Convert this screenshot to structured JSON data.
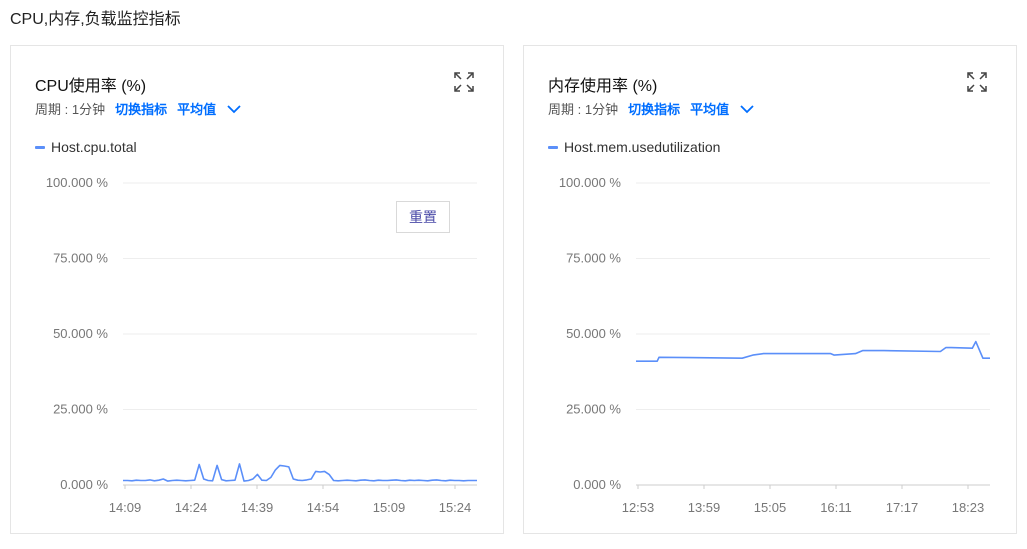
{
  "page": {
    "title": "CPU,内存,负载监控指标"
  },
  "colors": {
    "series": "#5b8ff9",
    "link": "#006eff",
    "grid": "#eeeeee",
    "axis_text": "#777777"
  },
  "icons": {
    "expand": "expand-icon",
    "dropdown": "chevron-down-icon"
  },
  "panels": [
    {
      "title": "CPU使用率 (%)",
      "period_label": "周期 : 1分钟",
      "switch_label": "切换指标",
      "agg_label": "平均值",
      "legend": "Host.cpu.total",
      "reset_label": "重置"
    },
    {
      "title": "内存使用率 (%)",
      "period_label": "周期 : 1分钟",
      "switch_label": "切换指标",
      "agg_label": "平均值",
      "legend": "Host.mem.usedutilization"
    }
  ],
  "chart_data": [
    {
      "type": "line",
      "title": "CPU使用率 (%)",
      "ylim": [
        0,
        100
      ],
      "yticks": [
        0,
        25,
        50,
        75,
        100
      ],
      "ytick_labels": [
        "0.000 %",
        "25.000 %",
        "50.000 %",
        "75.000 %",
        "100.000 %"
      ],
      "xtick_labels": [
        "14:09",
        "14:24",
        "14:39",
        "14:54",
        "15:09",
        "15:24"
      ],
      "grid": true,
      "legend_position": "top-left",
      "series": [
        {
          "name": "Host.cpu.total",
          "x": [
            0,
            1,
            2,
            3,
            4,
            5,
            6,
            7,
            8,
            9,
            10,
            11,
            12,
            13,
            14,
            15,
            16,
            17,
            18,
            19,
            20,
            21,
            22,
            23,
            24,
            25,
            26,
            27,
            28,
            29,
            30,
            31,
            32,
            33,
            34,
            35,
            36,
            37,
            38,
            39,
            40,
            41,
            42,
            43,
            44,
            45,
            46,
            47,
            48,
            49,
            50,
            51,
            52,
            53,
            54,
            55,
            56,
            57,
            58,
            59,
            60,
            61,
            62,
            63,
            64,
            65,
            66,
            67,
            68,
            69,
            70,
            71,
            72,
            73,
            74,
            75,
            76,
            77,
            78,
            79
          ],
          "values": [
            1.5,
            1.5,
            1.4,
            1.6,
            1.5,
            1.5,
            1.7,
            1.4,
            1.6,
            2.0,
            1.3,
            1.5,
            1.6,
            1.5,
            1.4,
            1.5,
            1.6,
            6.8,
            2.0,
            1.5,
            1.4,
            6.5,
            1.8,
            1.4,
            1.5,
            1.6,
            7.0,
            1.3,
            1.5,
            2.0,
            3.5,
            1.6,
            1.5,
            2.5,
            5.0,
            6.5,
            6.3,
            6.0,
            2.0,
            1.6,
            1.5,
            1.7,
            2.0,
            4.5,
            4.3,
            4.5,
            3.5,
            1.5,
            1.4,
            1.5,
            1.6,
            1.5,
            1.4,
            1.6,
            1.7,
            1.5,
            1.4,
            1.6,
            1.5,
            1.5,
            1.6,
            1.7,
            1.5,
            1.4,
            1.6,
            1.5,
            1.6,
            1.5,
            1.4,
            1.6,
            1.7,
            1.5,
            1.4,
            1.6,
            1.5,
            1.5,
            1.4,
            1.5,
            1.5,
            1.5
          ]
        }
      ]
    },
    {
      "type": "line",
      "title": "内存使用率 (%)",
      "ylim": [
        0,
        100
      ],
      "yticks": [
        0,
        25,
        50,
        75,
        100
      ],
      "ytick_labels": [
        "0.000 %",
        "25.000 %",
        "50.000 %",
        "75.000 %",
        "100.000 %"
      ],
      "xtick_labels": [
        "12:53",
        "13:59",
        "15:05",
        "16:11",
        "17:17",
        "18:23"
      ],
      "grid": true,
      "legend_position": "top-left",
      "series": [
        {
          "name": "Host.mem.usedutilization",
          "x": [
            0,
            6,
            6.5,
            15,
            30,
            33,
            36,
            55,
            56,
            62,
            64,
            70,
            86,
            87.5,
            88,
            89,
            95,
            96,
            98,
            100
          ],
          "values": [
            41,
            41,
            42.3,
            42.2,
            42,
            43,
            43.5,
            43.5,
            43,
            43.5,
            44.5,
            44.5,
            44.2,
            45.5,
            45.5,
            45.5,
            45.3,
            47.5,
            42,
            42
          ]
        }
      ]
    }
  ]
}
